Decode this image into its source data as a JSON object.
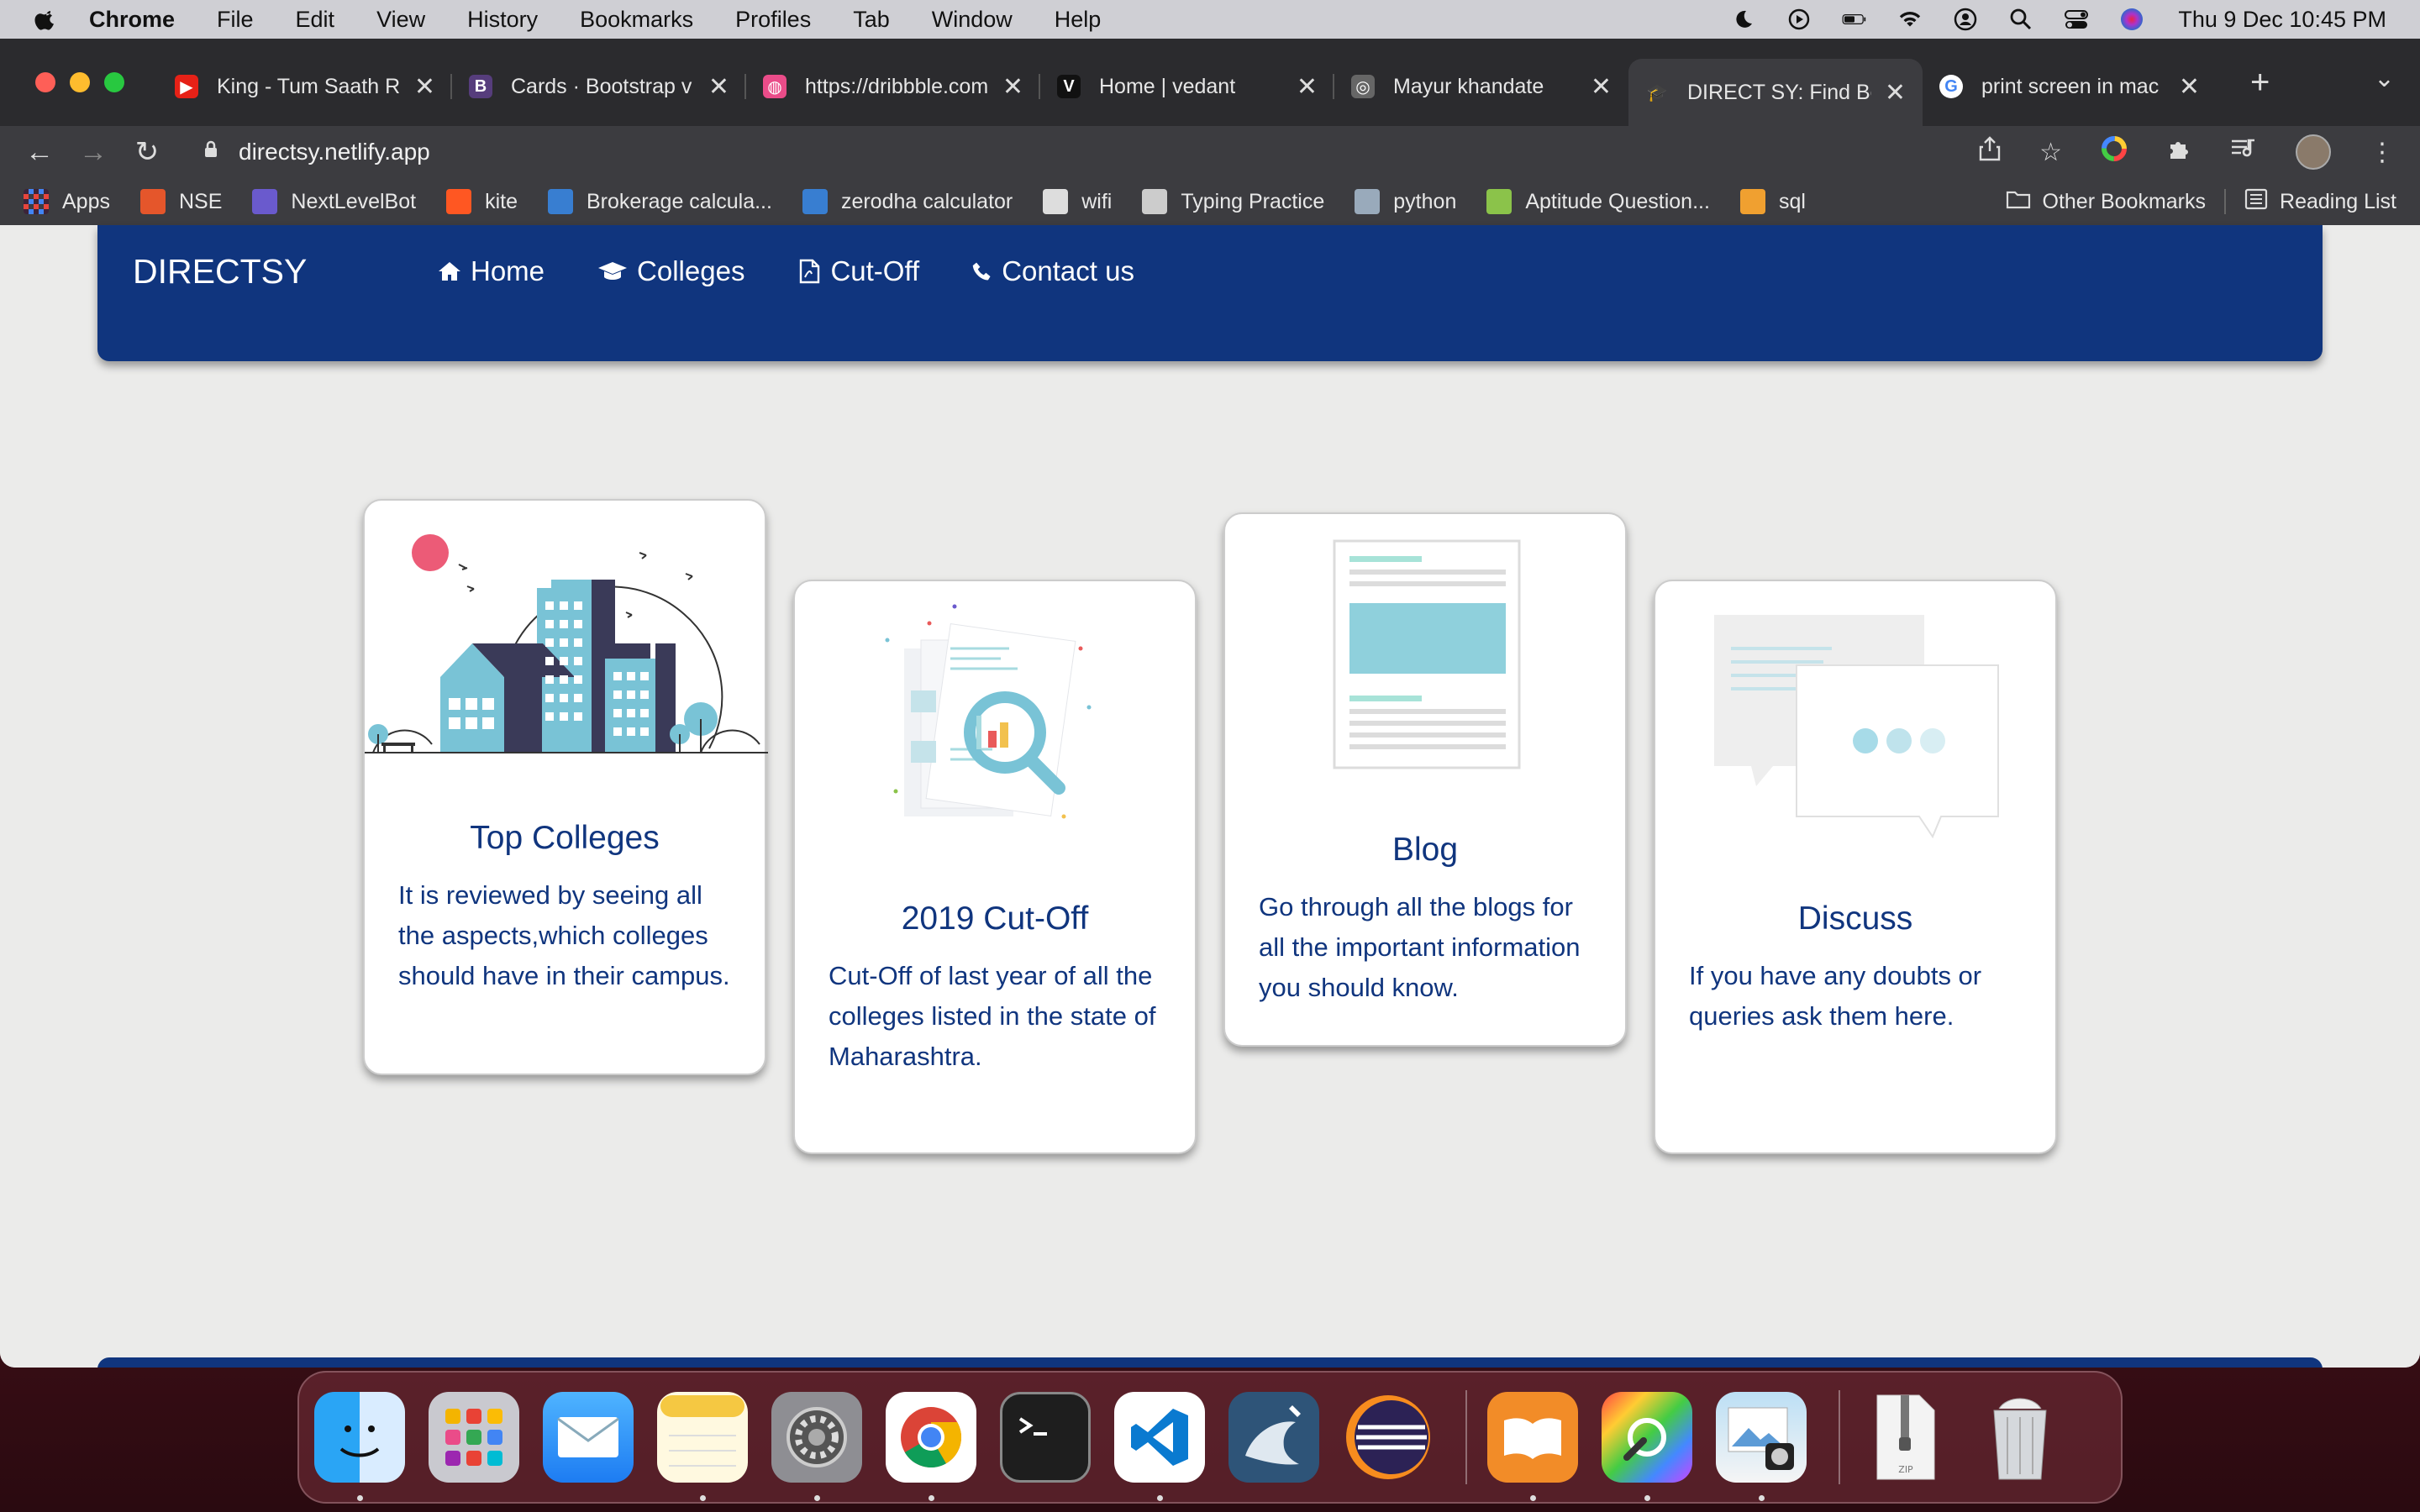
{
  "menubar": {
    "app": "Chrome",
    "items": [
      "File",
      "Edit",
      "View",
      "History",
      "Bookmarks",
      "Profiles",
      "Tab",
      "Window",
      "Help"
    ],
    "datetime": "Thu 9 Dec  10:45 PM"
  },
  "tabs": [
    {
      "title": "King - Tum Saath R",
      "fav": "youtube",
      "color": "#e62117",
      "glyph": "▶"
    },
    {
      "title": "Cards · Bootstrap v",
      "fav": "bootstrap",
      "color": "#563d7c",
      "glyph": "B"
    },
    {
      "title": "https://dribbble.com",
      "fav": "dribbble",
      "color": "#ea4c89",
      "glyph": "◍"
    },
    {
      "title": "Home | vedant",
      "fav": "vercel",
      "color": "#111111",
      "glyph": "V"
    },
    {
      "title": "Mayur khandate",
      "fav": "globe",
      "color": "#666666",
      "glyph": "◎"
    },
    {
      "title": "DIRECT SY: Find Be",
      "fav": "directsy",
      "color": "#3c3c40",
      "glyph": "🎓",
      "active": true
    },
    {
      "title": "print screen in mac",
      "fav": "google",
      "color": "#ffffff",
      "glyph": "G"
    }
  ],
  "toolbar": {
    "url": "directsy.netlify.app"
  },
  "bookmarks": [
    {
      "label": "Apps",
      "color": "#e8453c"
    },
    {
      "label": "NSE",
      "color": "#e5562b"
    },
    {
      "label": "NextLevelBot",
      "color": "#6a5acd"
    },
    {
      "label": "kite",
      "color": "#ff5722"
    },
    {
      "label": "Brokerage calcula...",
      "color": "#387ed1"
    },
    {
      "label": "zerodha calculator",
      "color": "#387ed1"
    },
    {
      "label": "wifi",
      "color": "#dddddd"
    },
    {
      "label": "Typing Practice",
      "color": "#cccccc"
    },
    {
      "label": "python",
      "color": "#9ab"
    },
    {
      "label": "Aptitude Question...",
      "color": "#8bc34a"
    },
    {
      "label": "sql",
      "color": "#f0a030"
    }
  ],
  "bookmarks_right": [
    "Other Bookmarks",
    "Reading List"
  ],
  "site": {
    "brand": "DIRECTSY",
    "nav": [
      {
        "label": "Home",
        "icon": "home-icon"
      },
      {
        "label": "Colleges",
        "icon": "graduation-cap-icon"
      },
      {
        "label": "Cut-Off",
        "icon": "pdf-file-icon"
      },
      {
        "label": "Contact us",
        "icon": "phone-icon"
      }
    ],
    "cards": [
      {
        "title": "Top Colleges",
        "text": "It is reviewed by seeing all the aspects,which colleges should have in their campus."
      },
      {
        "title": "2019 Cut-Off",
        "text": "Cut-Off of last year of all the colleges listed in the state of Maharashtra."
      },
      {
        "title": "Blog",
        "text": "Go through all the blogs for all the important information you should know."
      },
      {
        "title": "Discuss",
        "text": "If you have any doubts or queries ask them here."
      }
    ]
  },
  "dock": [
    "Finder",
    "Launchpad",
    "Mail",
    "Notes",
    "System Preferences",
    "Google Chrome",
    "Terminal",
    "Visual Studio Code",
    "MySQL Workbench",
    "Eclipse",
    "Books",
    "ColorSync Utility",
    "Preview",
    "Archive",
    "Trash"
  ],
  "colors": {
    "primary": "#10357e",
    "page_bg": "#ebebea"
  }
}
